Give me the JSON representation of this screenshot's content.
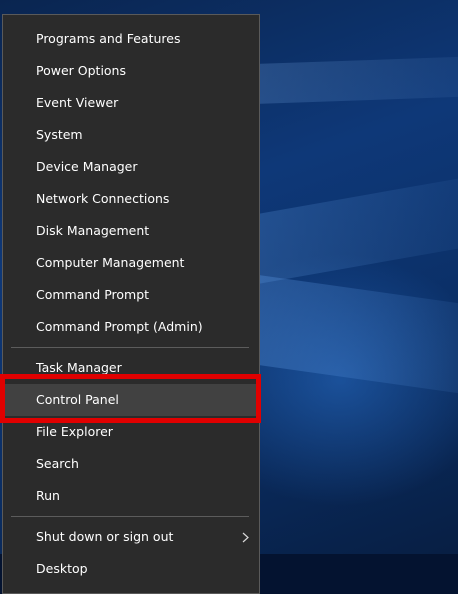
{
  "menu": {
    "groups": [
      [
        {
          "label": "Programs and Features",
          "hover": false
        },
        {
          "label": "Power Options",
          "hover": false
        },
        {
          "label": "Event Viewer",
          "hover": false
        },
        {
          "label": "System",
          "hover": false
        },
        {
          "label": "Device Manager",
          "hover": false
        },
        {
          "label": "Network Connections",
          "hover": false
        },
        {
          "label": "Disk Management",
          "hover": false
        },
        {
          "label": "Computer Management",
          "hover": false
        },
        {
          "label": "Command Prompt",
          "hover": false
        },
        {
          "label": "Command Prompt (Admin)",
          "hover": false
        }
      ],
      [
        {
          "label": "Task Manager",
          "hover": false
        },
        {
          "label": "Control Panel",
          "hover": true
        },
        {
          "label": "File Explorer",
          "hover": false
        },
        {
          "label": "Search",
          "hover": false
        },
        {
          "label": "Run",
          "hover": false
        }
      ],
      [
        {
          "label": "Shut down or sign out",
          "hover": false,
          "submenu": true
        },
        {
          "label": "Desktop",
          "hover": false
        }
      ]
    ]
  },
  "colors": {
    "menu_background": "#2b2b2b",
    "menu_hover": "#414141",
    "highlight_border": "#e00000",
    "text": "#ffffff"
  },
  "icons": {
    "submenu": "chevron-right-icon"
  }
}
